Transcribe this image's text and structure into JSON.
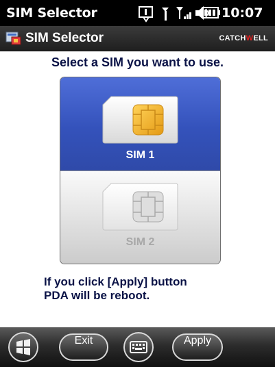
{
  "status_bar": {
    "title": "SIM Selector",
    "time": "10:07",
    "icons": [
      "connectivity-icon",
      "antenna-icon",
      "signal-icon",
      "volume-icon",
      "battery-icon"
    ]
  },
  "app_bar": {
    "title": "SIM Selector",
    "icon": "sim-selector-app-icon",
    "brand": {
      "prefix": "CATCH",
      "w": "W",
      "suffix": "ELL"
    }
  },
  "main": {
    "prompt": "Select a SIM you want to use.",
    "sims": [
      {
        "label": "SIM 1",
        "selected": true
      },
      {
        "label": "SIM 2",
        "selected": false
      }
    ],
    "notice": [
      "If you click [Apply] button",
      "PDA will be reboot."
    ]
  },
  "softkeys": {
    "start_icon": "windows-start-icon",
    "exit_label": "Exit",
    "keyboard_icon": "keyboard-icon",
    "apply_label": "Apply"
  },
  "colors": {
    "selected_bg": "#3452bb",
    "prompt_text": "#0a1246",
    "chip_active": "#f2b42a",
    "brand_accent": "#e02020"
  }
}
